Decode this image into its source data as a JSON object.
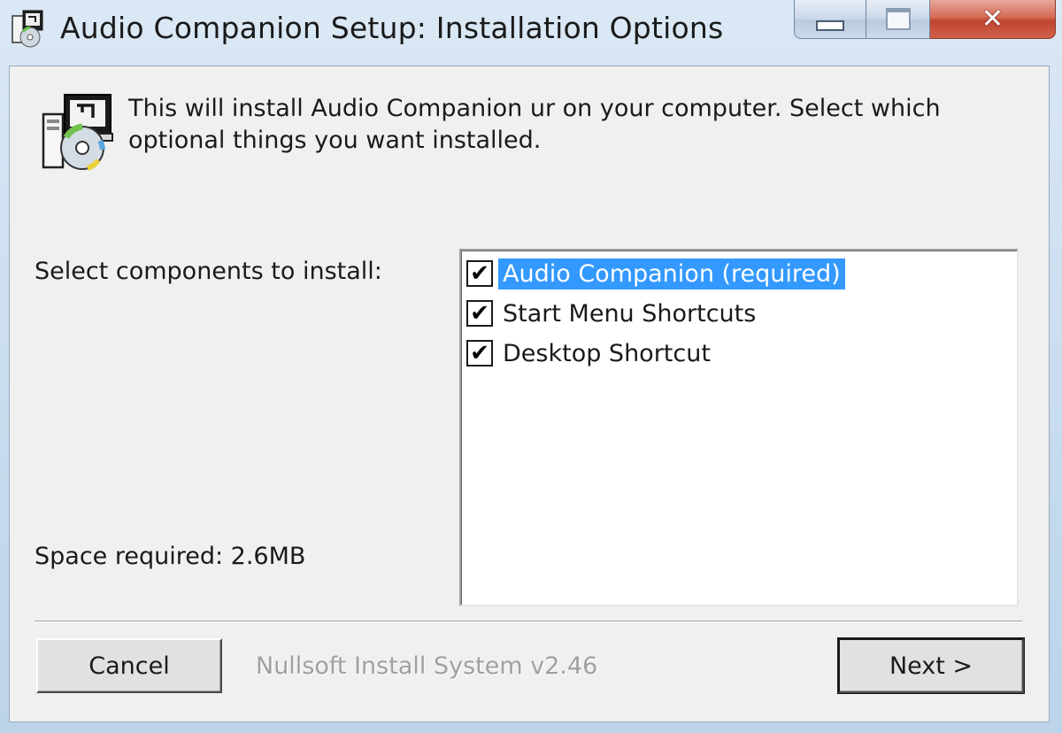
{
  "window": {
    "title": "Audio Companion Setup: Installation Options",
    "icon": "installer-icon",
    "controls": {
      "minimize": "minimize-icon",
      "maximize": "maximize-icon",
      "close": "close-icon"
    }
  },
  "header": {
    "text": "This will install Audio Companion       ur on your computer. Select which optional things you want installed.",
    "icon": "installer-cd-icon"
  },
  "components": {
    "label": "Select components to install:",
    "items": [
      {
        "label": "Audio Companion (required)",
        "checked": true,
        "selected": true
      },
      {
        "label": "Start Menu Shortcuts",
        "checked": true,
        "selected": false
      },
      {
        "label": "Desktop Shortcut",
        "checked": true,
        "selected": false
      }
    ],
    "check_glyph": "✔"
  },
  "space": {
    "text": "Space required: 2.6MB"
  },
  "footer": {
    "cancel_label": "Cancel",
    "branding": "Nullsoft Install System v2.46",
    "next_label": "Next >"
  },
  "colors": {
    "selection": "#3399ff",
    "dialog_bg": "#f0f0f0",
    "close_button": "#c04530"
  }
}
